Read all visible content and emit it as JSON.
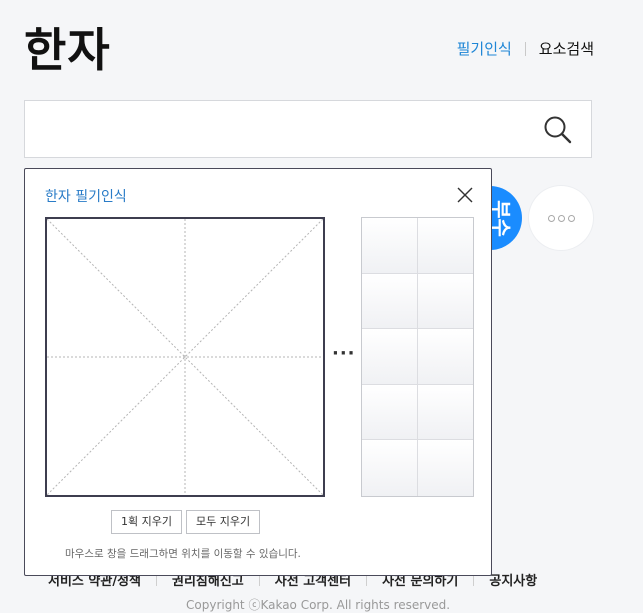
{
  "header": {
    "title": "한자",
    "links": [
      "필기인식",
      "요소검색"
    ]
  },
  "search": {
    "value": "",
    "placeholder": ""
  },
  "circles": {
    "blue_label": "부수"
  },
  "handwriting_panel": {
    "title": "한자 필기인식",
    "ellipsis": "···",
    "candidates": [
      "",
      "",
      "",
      "",
      "",
      "",
      "",
      "",
      "",
      ""
    ],
    "buttons": {
      "undo_stroke": "1획 지우기",
      "clear_all": "모두 지우기"
    },
    "note": "마우스로 창을 드래그하면 위치를 이동할 수 있습니다."
  },
  "footer": {
    "links": [
      "서비스 약관/정책",
      "권리침해신고",
      "사전 고객센터",
      "사전 문의하기",
      "공지사항"
    ],
    "copyright": "Copyright ⓒKakao Corp. All rights reserved."
  },
  "colors": {
    "accent_link": "#1f86d6",
    "blue_button": "#1a8cff",
    "panel_border": "#4a4a5a"
  }
}
